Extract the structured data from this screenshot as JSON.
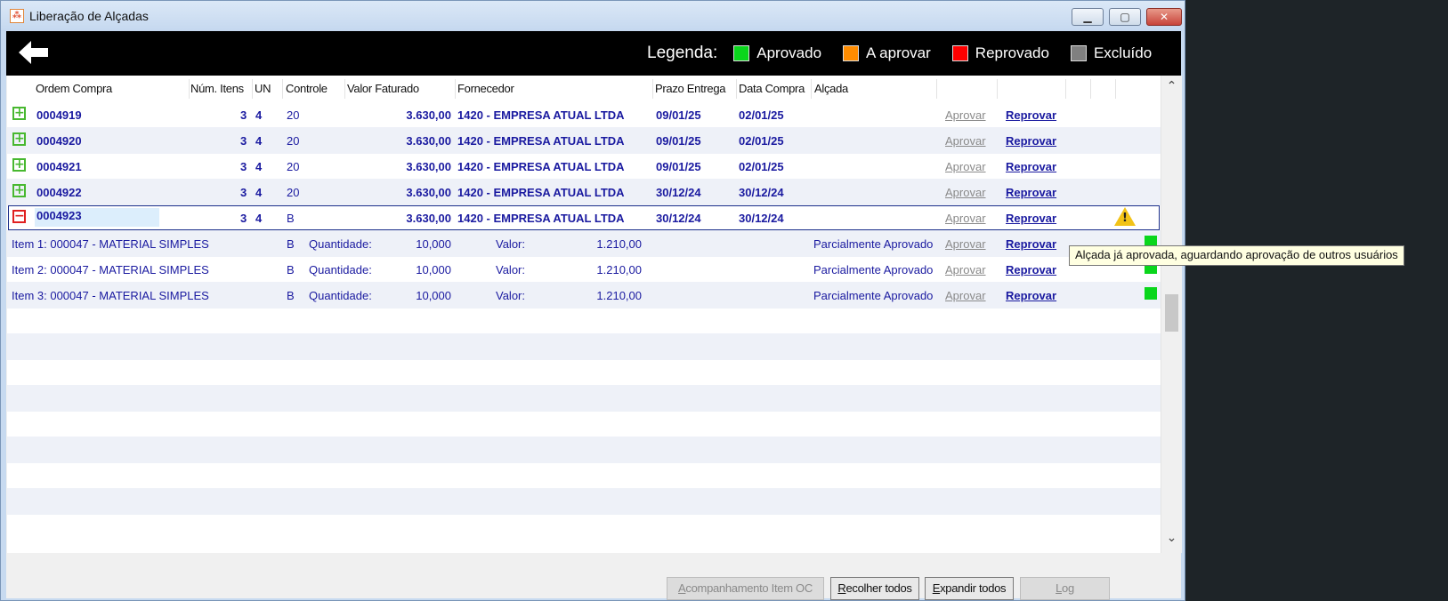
{
  "window": {
    "title": "Liberação de Alçadas"
  },
  "legend": {
    "label": "Legenda:",
    "items": [
      {
        "label": "Aprovado",
        "color": "#0ad61c"
      },
      {
        "label": "A aprovar",
        "color": "#ff8c00"
      },
      {
        "label": "Reprovado",
        "color": "#ff0000"
      },
      {
        "label": "Excluído",
        "color": "#808080"
      }
    ]
  },
  "columns": {
    "ordem": "Ordem Compra",
    "num_itens": "Núm. Itens",
    "un": "UN",
    "controle": "Controle",
    "valor": "Valor Faturado",
    "fornecedor": "Fornecedor",
    "prazo": "Prazo Entrega",
    "data": "Data Compra",
    "alcada": "Alçada"
  },
  "orders": [
    {
      "ordem": "0004919",
      "num": "3",
      "un": "4",
      "controle": "20",
      "valor": "3.630,00",
      "fornecedor": "1420 - EMPRESA ATUAL LTDA",
      "prazo": "09/01/25",
      "data": "02/01/25",
      "aprovar": "Aprovar",
      "reprovar": "Reprovar"
    },
    {
      "ordem": "0004920",
      "num": "3",
      "un": "4",
      "controle": "20",
      "valor": "3.630,00",
      "fornecedor": "1420 - EMPRESA ATUAL LTDA",
      "prazo": "09/01/25",
      "data": "02/01/25",
      "aprovar": "Aprovar",
      "reprovar": "Reprovar"
    },
    {
      "ordem": "0004921",
      "num": "3",
      "un": "4",
      "controle": "20",
      "valor": "3.630,00",
      "fornecedor": "1420 - EMPRESA ATUAL LTDA",
      "prazo": "09/01/25",
      "data": "02/01/25",
      "aprovar": "Aprovar",
      "reprovar": "Reprovar"
    },
    {
      "ordem": "0004922",
      "num": "3",
      "un": "4",
      "controle": "20",
      "valor": "3.630,00",
      "fornecedor": "1420 - EMPRESA ATUAL LTDA",
      "prazo": "30/12/24",
      "data": "30/12/24",
      "aprovar": "Aprovar",
      "reprovar": "Reprovar"
    },
    {
      "ordem": "0004923",
      "num": "3",
      "un": "4",
      "controle": "B",
      "valor": "3.630,00",
      "fornecedor": "1420 - EMPRESA ATUAL LTDA",
      "prazo": "30/12/24",
      "data": "30/12/24",
      "aprovar": "Aprovar",
      "reprovar": "Reprovar"
    }
  ],
  "items": [
    {
      "desc": "Item 1: 000047 - MATERIAL SIMPLES",
      "controle": "B",
      "qtd_label": "Quantidade:",
      "qtd": "10,000",
      "valor_label": "Valor:",
      "valor": "1.210,00",
      "alcada": "Parcialmente Aprovado",
      "aprovar": "Aprovar",
      "reprovar": "Reprovar"
    },
    {
      "desc": "Item 2: 000047 - MATERIAL SIMPLES",
      "controle": "B",
      "qtd_label": "Quantidade:",
      "qtd": "10,000",
      "valor_label": "Valor:",
      "valor": "1.210,00",
      "alcada": "Parcialmente Aprovado",
      "aprovar": "Aprovar",
      "reprovar": "Reprovar"
    },
    {
      "desc": "Item 3: 000047 - MATERIAL SIMPLES",
      "controle": "B",
      "qtd_label": "Quantidade:",
      "qtd": "10,000",
      "valor_label": "Valor:",
      "valor": "1.210,00",
      "alcada": "Parcialmente Aprovado",
      "aprovar": "Aprovar",
      "reprovar": "Reprovar"
    }
  ],
  "tooltip": "Alçada já aprovada, aguardando aprovação de outros usuários",
  "footer": {
    "acompanhamento_pre": "",
    "acompanhamento_u": "A",
    "acompanhamento_post": "companhamento Item OC",
    "recolher_u": "R",
    "recolher_post": "ecolher todos",
    "expandir_u": "E",
    "expandir_post": "xpandir todos",
    "log_u": "L",
    "log_post": "og"
  }
}
